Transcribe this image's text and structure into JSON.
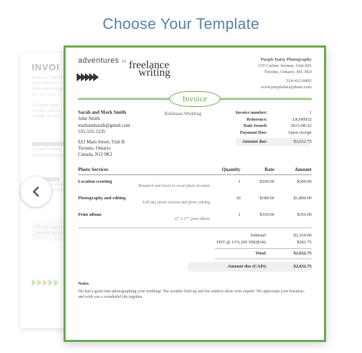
{
  "heading": "Choose Your Template",
  "logo": {
    "line1": "adventures",
    "line1_suffix": "in",
    "line2": "freelance",
    "line3": "writing"
  },
  "company": {
    "name": "Purple Daisy Photography",
    "addr1": "235 Carlaw Avenue, Unit 601",
    "addr2": "Toronto, Ontario, M5 3K0",
    "phone": "514-412-8492",
    "site": "www.purpledaisyphoto.com"
  },
  "invoice_label": "Invoice",
  "event_name": "Robinson Wedding",
  "client": {
    "name": "Sarah and Mark Smith",
    "contact": "John Smith",
    "email": "markandsarah@gmail.com",
    "phone": "555-555-1235",
    "addr1": "823 Main Street, Unit B",
    "addr2": "Toronto, Ontario",
    "addr3": "Canada, N1J 9K2"
  },
  "info": {
    "invoice_number_lbl": "Invoice number:",
    "invoice_number": "1",
    "reference_lbl": "Reference:",
    "reference": "LKJS0932",
    "date_issued_lbl": "Date Issued:",
    "date_issued": "2015-08-22",
    "payment_due_lbl": "Payment Due:",
    "payment_due": "Upon receipt",
    "amount_due_lbl": "Amount due:",
    "amount_due": "$2,632.75"
  },
  "columns": {
    "service": "Photo Services",
    "qty": "Quantity",
    "rate": "Rate",
    "amount": "Amount"
  },
  "items": [
    {
      "name": "Location scouting",
      "desc": "Research and travel to scout photo location",
      "qty": "1",
      "rate": "$200.00",
      "amount": "$200.00"
    },
    {
      "name": "Photography and editing",
      "desc": "Full-day photo session and photo editing",
      "qty": "10",
      "rate": "$180.00",
      "amount": "$1,800.00"
    },
    {
      "name": "Print album",
      "desc": "12\" x 17\" print album",
      "qty": "1",
      "rate": "$350.00",
      "amount": "$350.00"
    }
  ],
  "totals": {
    "subtotal_lbl": "Subtotal:",
    "subtotal": "$2,350.00",
    "tax_lbl": "HST @ 13% (ID 3092834):",
    "tax": "$282.75",
    "total_lbl": "Total:",
    "total": "$2,632.75",
    "due_lbl": "Amount due (CAD):",
    "due": "$2,632.75"
  },
  "notes": {
    "heading": "Notes",
    "body": "We had a great time photographing your wedding! The weather held up and the outdoor shots were superb. We appreciate your business, and wish you a wonderful life together."
  },
  "bg_card": {
    "title": "INVOI"
  }
}
